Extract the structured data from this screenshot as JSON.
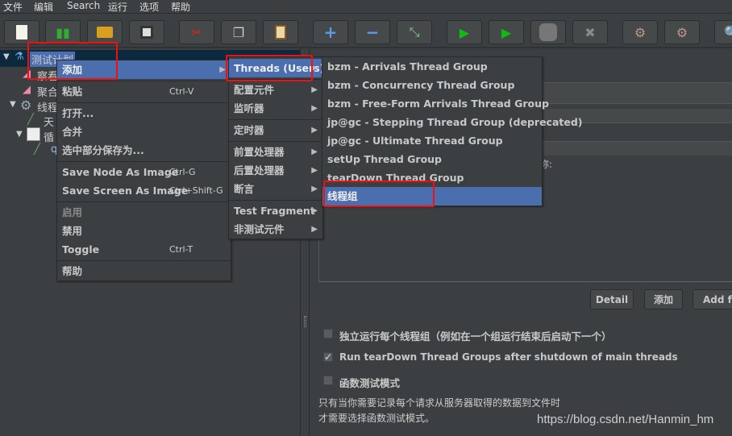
{
  "menubar": [
    "文件",
    "编辑",
    "Search",
    "运行",
    "选项",
    "帮助"
  ],
  "toolbar": [
    "new-icon",
    "templates-icon",
    "open-icon",
    "save-icon",
    "cut-icon",
    "copy-icon",
    "paste-icon",
    "expand-icon",
    "collapse-icon",
    "toggle-icon",
    "start-icon",
    "start-no-pause-icon",
    "stop-icon",
    "shutdown-icon",
    "clear-icon",
    "clear-all-icon",
    "search-icon"
  ],
  "tree": {
    "root": "测试计划",
    "items": [
      "察看",
      "聚合",
      "线程",
      "天",
      "循",
      "q"
    ]
  },
  "context_menu": {
    "items": [
      {
        "label": "添加",
        "has_submenu": true,
        "highlighted": true
      },
      {
        "label": "粘贴",
        "shortcut": "Ctrl-V"
      },
      {
        "label": "打开..."
      },
      {
        "label": "合并"
      },
      {
        "label": "选中部分保存为..."
      },
      {
        "label": "Save Node As Image",
        "shortcut": "Ctrl-G"
      },
      {
        "label": "Save Screen As Image",
        "shortcut": "Ctrl+Shift-G"
      },
      {
        "label": "启用",
        "disabled": true
      },
      {
        "label": "禁用"
      },
      {
        "label": "Toggle",
        "shortcut": "Ctrl-T"
      },
      {
        "label": "帮助"
      }
    ]
  },
  "add_submenu": {
    "items": [
      "Threads (Users)",
      "配置元件",
      "监听器",
      "定时器",
      "前置处理器",
      "后置处理器",
      "断言",
      "Test Fragment",
      "非测试元件"
    ]
  },
  "threads_submenu": {
    "items": [
      "bzm - Arrivals Thread Group",
      "bzm - Concurrency Thread Group",
      "bzm - Free-Form Arrivals Thread Group",
      "jp@gc - Stepping Thread Group (deprecated)",
      "jp@gc - Ultimate Thread Group",
      "setUp Thread Group",
      "tearDown Thread Group",
      "线程组"
    ],
    "highlighted": "线程组"
  },
  "panel": {
    "partial_label": "称:",
    "buttons": {
      "detail": "Detail",
      "add": "添加",
      "add_from": "Add fr"
    },
    "checkboxes": [
      {
        "label": "独立运行每个线程组（例如在一个组运行结束后启动下一个）",
        "checked": false
      },
      {
        "label": "Run tearDown Thread Groups after shutdown of main threads",
        "checked": true
      },
      {
        "label": "函数测试模式",
        "checked": false
      }
    ],
    "note_line1": "只有当你需要记录每个请求从服务器取得的数据到文件时",
    "note_line2": "才需要选择函数测试模式。"
  },
  "watermark": "https://blog.csdn.net/Hanmin_hm",
  "colors": {
    "highlight": "#4b6eaf",
    "annotation": "#f01010",
    "background": "#3c3f41"
  }
}
